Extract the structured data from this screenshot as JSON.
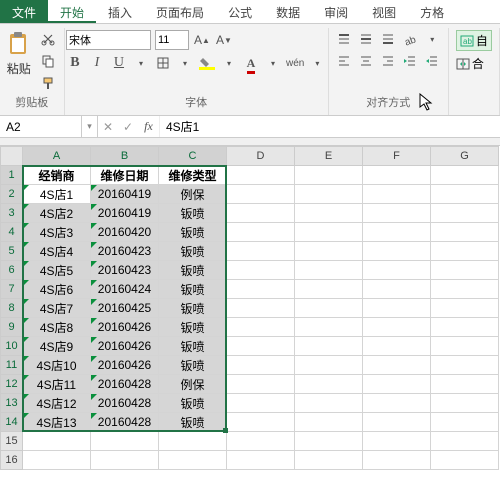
{
  "menu": {
    "file": "文件",
    "tabs": [
      "开始",
      "插入",
      "页面布局",
      "公式",
      "数据",
      "审阅",
      "视图",
      "方格"
    ]
  },
  "ribbon": {
    "clipboard_label": "剪贴板",
    "paste_label": "粘贴",
    "font_label": "字体",
    "font_name": "宋体",
    "font_size": "11",
    "align_label": "对齐方式",
    "wrap_text": "自",
    "merge_text": "合"
  },
  "name_box": "A2",
  "formula_value": "4S店1",
  "columns": [
    "A",
    "B",
    "C",
    "D",
    "E",
    "F",
    "G"
  ],
  "row_numbers": [
    "1",
    "2",
    "3",
    "4",
    "5",
    "6",
    "7",
    "8",
    "9",
    "10",
    "11",
    "12",
    "13",
    "14",
    "15",
    "16"
  ],
  "headers": [
    "经销商",
    "维修日期",
    "维修类型"
  ],
  "rows": [
    [
      "4S店1",
      "20160419",
      "例保"
    ],
    [
      "4S店2",
      "20160419",
      "钣喷"
    ],
    [
      "4S店3",
      "20160420",
      "钣喷"
    ],
    [
      "4S店4",
      "20160423",
      "钣喷"
    ],
    [
      "4S店5",
      "20160423",
      "钣喷"
    ],
    [
      "4S店6",
      "20160424",
      "钣喷"
    ],
    [
      "4S店7",
      "20160425",
      "钣喷"
    ],
    [
      "4S店8",
      "20160426",
      "钣喷"
    ],
    [
      "4S店9",
      "20160426",
      "钣喷"
    ],
    [
      "4S店10",
      "20160426",
      "钣喷"
    ],
    [
      "4S店11",
      "20160428",
      "例保"
    ],
    [
      "4S店12",
      "20160428",
      "钣喷"
    ],
    [
      "4S店13",
      "20160428",
      "钣喷"
    ]
  ]
}
